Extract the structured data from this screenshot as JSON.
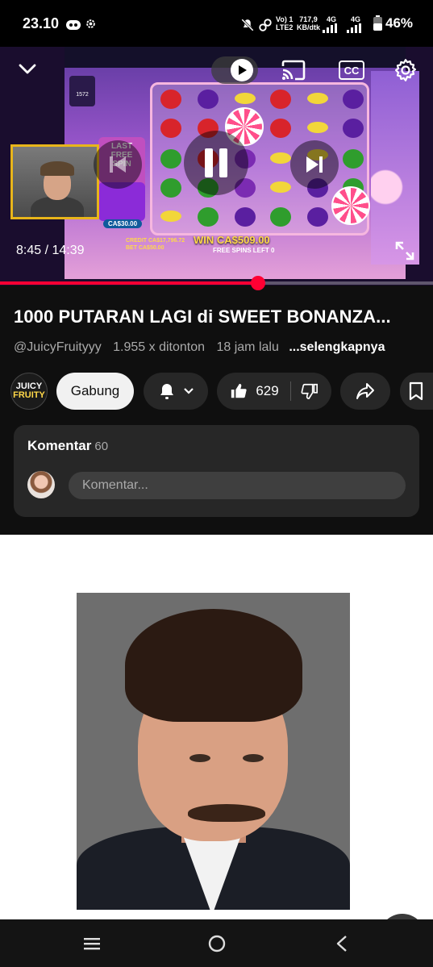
{
  "status_bar": {
    "time": "23.10",
    "net_line1": "Vo) 1",
    "net_line2": "LTE2",
    "speed_value": "717,9",
    "speed_unit": "KB/dtk",
    "lte_a": "4G",
    "lte_b": "4G",
    "battery": "46%"
  },
  "player": {
    "time_current": "8:45",
    "time_total": "14:39",
    "time_label": "8:45 / 14:39",
    "progress": 0.596,
    "cc_label": "CC",
    "overlay": {
      "last_free_spin": "LAST FREE SPIN",
      "win": "WIN CA$509.00",
      "free_spins_left": "FREE SPINS LEFT 0",
      "credit": "CREDIT CA$17,796.72",
      "bet": "BET CA$50.00",
      "balance_chip": "CA$30.00",
      "jackpot": "1572"
    }
  },
  "video": {
    "title": "1000 PUTARAN LAGI di SWEET BONANZA...",
    "channel_handle": "@JuicyFruityyy",
    "views": "1.955 x ditonton",
    "age": "18 jam lalu",
    "more": "...selengkapnya"
  },
  "channel": {
    "avatar_line1": "JUICY",
    "avatar_line2": "FRUITY"
  },
  "actions": {
    "join": "Gabung",
    "likes": "629"
  },
  "comments": {
    "title": "Komentar",
    "count": "60",
    "placeholder": "Komentar..."
  },
  "icons": {
    "back": "chevron-down-icon",
    "play": "play-icon",
    "cast": "cast-icon",
    "captions": "cc-icon",
    "settings": "gear-icon",
    "pause": "pause-icon",
    "prev": "previous-icon",
    "next": "next-icon",
    "fullscreen": "fullscreen-icon",
    "bell": "bell-icon",
    "like": "thumbs-up-icon",
    "dislike": "thumbs-down-icon",
    "share": "share-icon",
    "save": "bookmark-icon"
  },
  "colors": {
    "accent": "#ff0033",
    "background": "#0f0f0f",
    "surface": "#272727"
  }
}
